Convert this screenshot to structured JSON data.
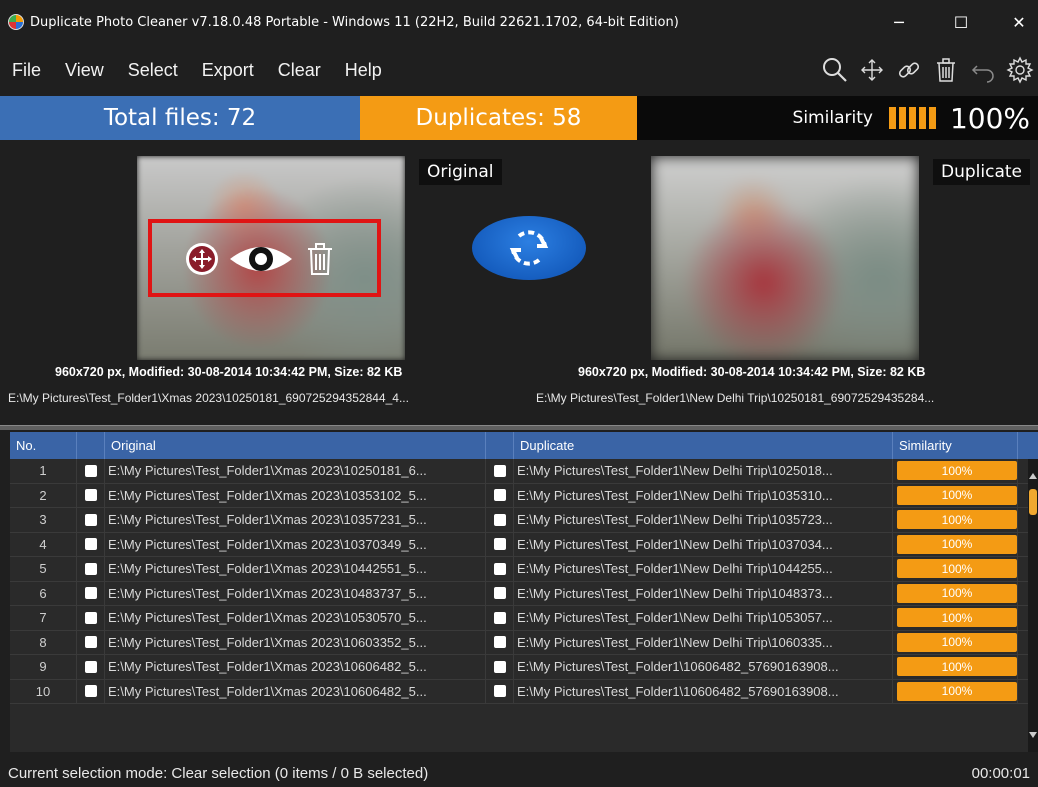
{
  "window": {
    "title": "Duplicate Photo Cleaner v7.18.0.48 Portable - Windows 11 (22H2, Build 22621.1702, 64-bit Edition)",
    "minimize_glyph": "─",
    "maximize_glyph": "☐",
    "close_glyph": "✕"
  },
  "menu": {
    "items": [
      "File",
      "View",
      "Select",
      "Export",
      "Clear",
      "Help"
    ]
  },
  "toolbar": {
    "icons": [
      "search-icon",
      "move-icon",
      "link-icon",
      "trash-icon",
      "undo-icon",
      "settings-icon"
    ]
  },
  "stats": {
    "total": "Total files: 72",
    "duplicates": "Duplicates: 58",
    "similarity_label": "Similarity",
    "similarity_value": "100%",
    "similarity_level": 1.0
  },
  "preview": {
    "original_label": "Original",
    "duplicate_label": "Duplicate",
    "original_info": "960x720 px, Modified: 30-08-2014 10:34:42 PM, Size: 82 KB",
    "duplicate_info": "960x720 px, Modified: 30-08-2014 10:34:42 PM, Size: 82 KB",
    "original_path": "E:\\My Pictures\\Test_Folder1\\Xmas 2023\\10250181_690725294352844_4...",
    "duplicate_path": "E:\\My Pictures\\Test_Folder1\\New Delhi Trip\\10250181_69072529435284...",
    "actions": [
      "move-icon",
      "view-icon",
      "delete-icon"
    ]
  },
  "grid": {
    "headers": {
      "no": "No.",
      "original": "Original",
      "duplicate": "Duplicate",
      "similarity": "Similarity"
    },
    "rows": [
      {
        "no": "1",
        "original": "E:\\My Pictures\\Test_Folder1\\Xmas 2023\\10250181_6...",
        "duplicate": "E:\\My Pictures\\Test_Folder1\\New Delhi Trip\\1025018...",
        "similarity": "100%"
      },
      {
        "no": "2",
        "original": "E:\\My Pictures\\Test_Folder1\\Xmas 2023\\10353102_5...",
        "duplicate": "E:\\My Pictures\\Test_Folder1\\New Delhi Trip\\1035310...",
        "similarity": "100%"
      },
      {
        "no": "3",
        "original": "E:\\My Pictures\\Test_Folder1\\Xmas 2023\\10357231_5...",
        "duplicate": "E:\\My Pictures\\Test_Folder1\\New Delhi Trip\\1035723...",
        "similarity": "100%"
      },
      {
        "no": "4",
        "original": "E:\\My Pictures\\Test_Folder1\\Xmas 2023\\10370349_5...",
        "duplicate": "E:\\My Pictures\\Test_Folder1\\New Delhi Trip\\1037034...",
        "similarity": "100%"
      },
      {
        "no": "5",
        "original": "E:\\My Pictures\\Test_Folder1\\Xmas 2023\\10442551_5...",
        "duplicate": "E:\\My Pictures\\Test_Folder1\\New Delhi Trip\\1044255...",
        "similarity": "100%"
      },
      {
        "no": "6",
        "original": "E:\\My Pictures\\Test_Folder1\\Xmas 2023\\10483737_5...",
        "duplicate": "E:\\My Pictures\\Test_Folder1\\New Delhi Trip\\1048373...",
        "similarity": "100%"
      },
      {
        "no": "7",
        "original": "E:\\My Pictures\\Test_Folder1\\Xmas 2023\\10530570_5...",
        "duplicate": "E:\\My Pictures\\Test_Folder1\\New Delhi Trip\\1053057...",
        "similarity": "100%"
      },
      {
        "no": "8",
        "original": "E:\\My Pictures\\Test_Folder1\\Xmas 2023\\10603352_5...",
        "duplicate": "E:\\My Pictures\\Test_Folder1\\New Delhi Trip\\1060335...",
        "similarity": "100%"
      },
      {
        "no": "9",
        "original": "E:\\My Pictures\\Test_Folder1\\Xmas 2023\\10606482_5...",
        "duplicate": "E:\\My Pictures\\Test_Folder1\\10606482_57690163908...",
        "similarity": "100%"
      },
      {
        "no": "10",
        "original": "E:\\My Pictures\\Test_Folder1\\Xmas 2023\\10606482_5...",
        "duplicate": "E:\\My Pictures\\Test_Folder1\\10606482_57690163908...",
        "similarity": "100%"
      }
    ]
  },
  "status": {
    "message": "Current selection mode: Clear selection (0 items / 0 B selected)",
    "timer": "00:00:01"
  },
  "colors": {
    "accent_blue": "#3b6fb5",
    "accent_orange": "#f49b14",
    "highlight_red": "#e01414",
    "background": "#1f1f1f"
  }
}
